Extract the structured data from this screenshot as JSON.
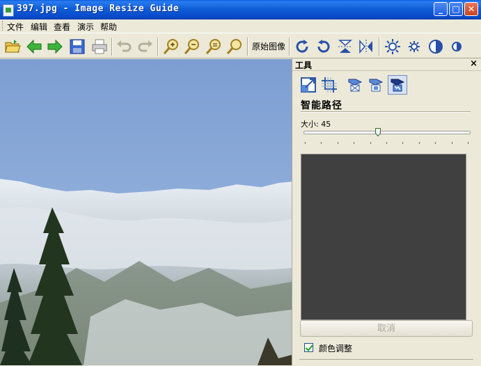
{
  "window": {
    "title": "397.jpg - Image Resize Guide"
  },
  "menu": [
    "文件",
    "编辑",
    "查看",
    "演示",
    "帮助"
  ],
  "toolbar": {
    "original_image_label": "原始图像",
    "icons": [
      "open-folder-icon",
      "back-arrow-icon",
      "forward-arrow-icon",
      "save-icon",
      "print-icon",
      "undo-icon",
      "redo-icon",
      "zoom-in-icon",
      "zoom-out-icon",
      "zoom-fit-icon",
      "zoom-actual-icon",
      "rotate-cw-icon",
      "rotate-ccw-icon",
      "flip-vertical-icon",
      "flip-horizontal-icon",
      "brightness-up-icon",
      "brightness-down-icon",
      "contrast-up-icon",
      "contrast-down-icon"
    ]
  },
  "panel": {
    "title": "工具",
    "close": "×",
    "section_title": "智能路径",
    "size_label": "大小: 45",
    "size_value": 45,
    "cancel_label": "取消",
    "color_adjust_label": "颜色调整",
    "color_adjust_checked": true
  },
  "colors": {
    "titlebar": "#0848c8",
    "panel_bg": "#ece9d8",
    "preview_bg": "#404040",
    "sky": "#86a6d8"
  }
}
